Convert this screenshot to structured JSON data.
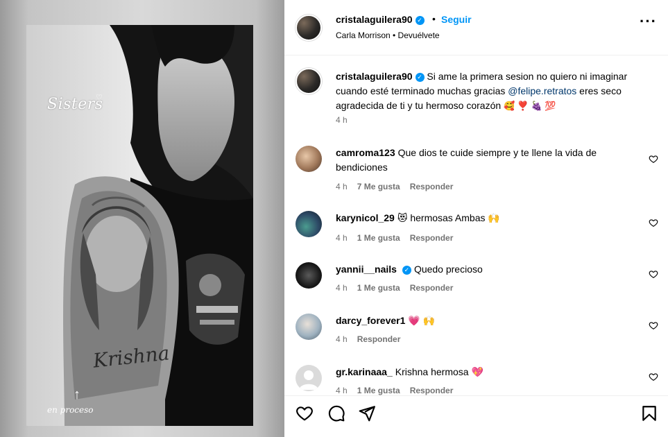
{
  "post": {
    "media": {
      "overlay_title": "Sisters",
      "tattoo_name": "Krishna",
      "progress_label": "en proceso"
    },
    "header": {
      "username": "cristalaguilera90",
      "verified": true,
      "separator": "•",
      "follow_label": "Seguir",
      "subtitle": "Carla Morrison • Devuélvete",
      "more_icon": "more-horizontal-icon"
    },
    "caption": {
      "username": "cristalaguilera90",
      "text_before_mention": "Si ame la primera sesion no quiero ni imaginar cuando esté terminado muchas gracias ",
      "mention": "@felipe.retratos",
      "text_after_mention": " eres seco agradecida de ti y tu hermoso corazón ",
      "emojis": "🥰 ❣️ 🍇 💯",
      "time": "4 h"
    },
    "comments": [
      {
        "username": "camroma123",
        "verified": false,
        "text": "Que dios te cuide siempre y te llene la vida de bendiciones",
        "time": "4 h",
        "likes": "7 Me gusta",
        "reply": "Responder"
      },
      {
        "username": "karynicol_29",
        "verified": false,
        "text": "😻 hermosas Ambas 🙌",
        "time": "4 h",
        "likes": "1 Me gusta",
        "reply": "Responder"
      },
      {
        "username": "yannii__nails",
        "verified": true,
        "text": "Quedo precioso",
        "time": "4 h",
        "likes": "1 Me gusta",
        "reply": "Responder"
      },
      {
        "username": "darcy_forever1",
        "verified": false,
        "text": "💗 🙌",
        "time": "4 h",
        "likes": "",
        "reply": "Responder"
      },
      {
        "username": "gr.karinaaa_",
        "verified": false,
        "text": "Krishna hermosa 💖",
        "time": "4 h",
        "likes": "1 Me gusta",
        "reply": "Responder"
      }
    ],
    "actions": {
      "like_icon": "heart-outline-icon",
      "comment_icon": "comment-bubble-icon",
      "share_icon": "paper-plane-icon",
      "save_icon": "bookmark-icon"
    },
    "colors": {
      "link_blue": "#0095f6",
      "mention_blue": "#00376b",
      "muted_text": "#737373",
      "divider": "#efefef"
    }
  }
}
